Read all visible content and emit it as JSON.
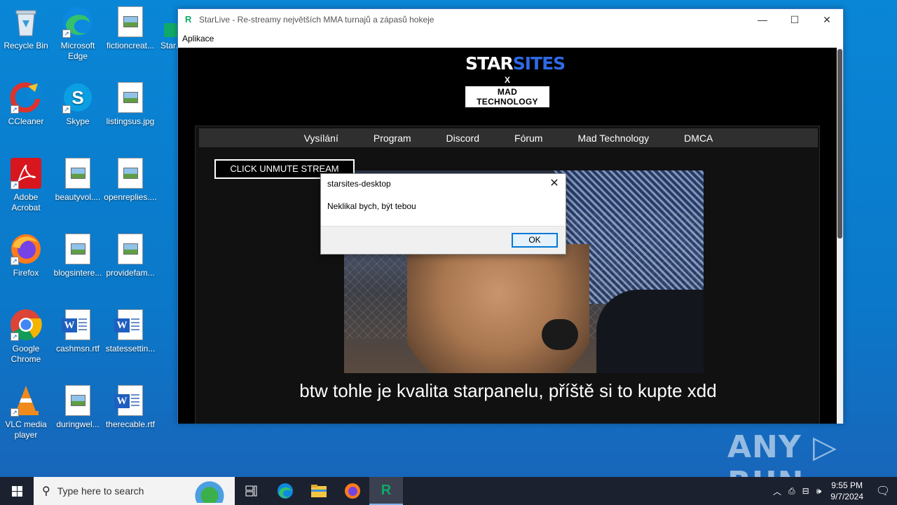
{
  "desktop": {
    "icons": [
      {
        "label": "Recycle Bin"
      },
      {
        "label": "Microsoft Edge"
      },
      {
        "label": "fictioncreat..."
      },
      {
        "label": "Star..."
      },
      {
        "label": "CCleaner"
      },
      {
        "label": "Skype"
      },
      {
        "label": "listingsus.jpg"
      },
      {
        "label": "Adobe Acrobat"
      },
      {
        "label": "beautyvol...."
      },
      {
        "label": "openreplies...."
      },
      {
        "label": "Firefox"
      },
      {
        "label": "blogsintere..."
      },
      {
        "label": "providefam..."
      },
      {
        "label": "Google Chrome"
      },
      {
        "label": "cashmsn.rtf"
      },
      {
        "label": "statessettin..."
      },
      {
        "label": "VLC media player"
      },
      {
        "label": "duringwel..."
      },
      {
        "label": "therecable.rtf"
      }
    ]
  },
  "window": {
    "title": "StarLive - Re-streamy největších MMA turnajů a zápasů hokeje",
    "menu": "Aplikace",
    "controls": {
      "minimize": "—",
      "maximize": "☐",
      "close": "✕"
    }
  },
  "site": {
    "logo": {
      "star": "STAR",
      "sites": "SITES",
      "x": "X",
      "mad": "MAD TECHNOLOGY"
    },
    "nav": [
      "Vysílání",
      "Program",
      "Discord",
      "Fórum",
      "Mad Technology",
      "DMCA"
    ],
    "unmute_button": "CLICK UNMUTE STREAM",
    "subtitle": "btw tohle je kvalita starpanelu, příště si to kupte xdd"
  },
  "dialog": {
    "title": "starsites-desktop",
    "message": "Neklikal bych, být tebou",
    "ok": "OK",
    "close": "✕"
  },
  "watermark": "ANY ▷ RUN",
  "taskbar": {
    "search_placeholder": "Type here to search",
    "time": "9:55 PM",
    "date": "9/7/2024"
  },
  "colors": {
    "desktop_bg": "#0a86d6",
    "taskbar_bg": "#1c2130",
    "accent_blue": "#0078d7",
    "logo_blue": "#2e6ae6"
  }
}
